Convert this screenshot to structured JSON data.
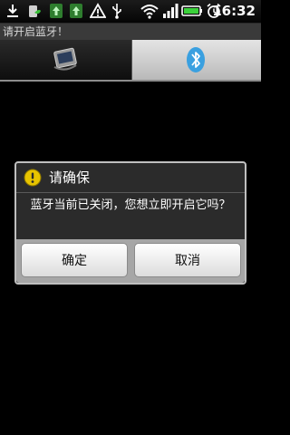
{
  "status_bar": {
    "time": "16:32",
    "icons": [
      "download-icon",
      "battery-saver-icon",
      "upload-icon",
      "upload-icon",
      "warning-icon",
      "usb-icon",
      "wifi-icon",
      "signal-icon",
      "battery-icon",
      "alarm-icon"
    ]
  },
  "title_bar": {
    "text": "请开启蓝牙！"
  },
  "tabs": [
    {
      "icon": "device-icon",
      "selected": false
    },
    {
      "icon": "bluetooth-icon",
      "selected": true
    }
  ],
  "dialog": {
    "title": "请确保",
    "message": "蓝牙当前已关闭，您想立即开启它吗？",
    "ok_label": "确定",
    "cancel_label": "取消"
  },
  "colors": {
    "background": "#000000",
    "dialog_bg": "#2b2b2b",
    "accent": "#3aa0e0"
  }
}
